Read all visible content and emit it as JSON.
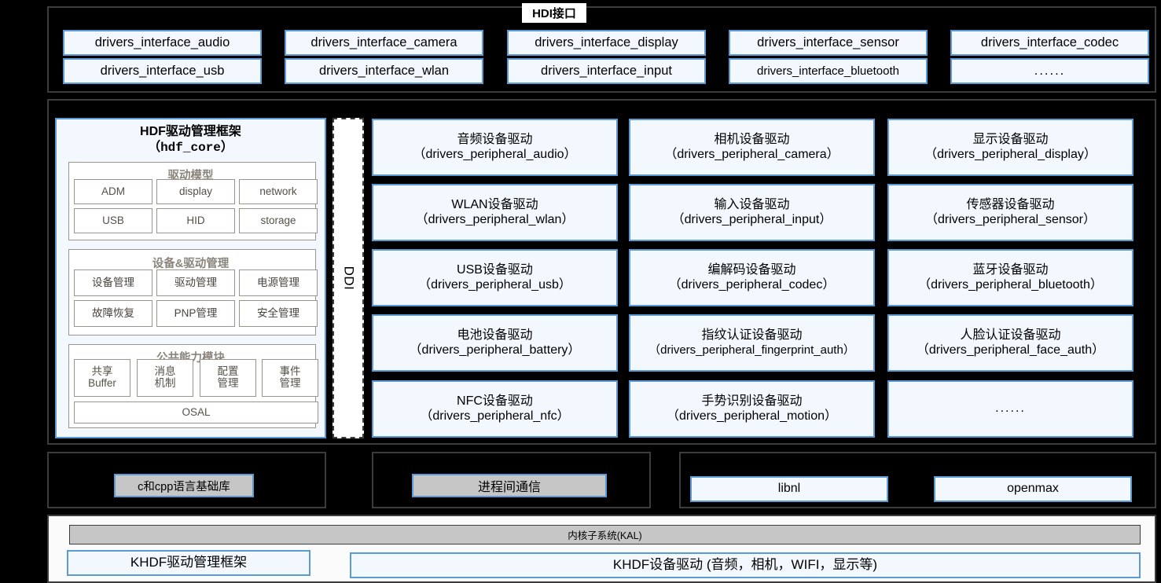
{
  "hdi": {
    "label": "HDI接口"
  },
  "interfaces": [
    {
      "name": "drivers_interface_audio"
    },
    {
      "name": "drivers_interface_usb"
    },
    {
      "name": "drivers_interface_camera"
    },
    {
      "name": "drivers_interface_wlan"
    },
    {
      "name": "drivers_interface_display"
    },
    {
      "name": "drivers_interface_input"
    },
    {
      "name": "drivers_interface_sensor"
    },
    {
      "name": "drivers_interface_bluetooth"
    },
    {
      "name": "drivers_interface_codec"
    },
    {
      "name": "......"
    }
  ],
  "ddi": {
    "label": "DDI"
  },
  "hdf_core": {
    "title": "HDF驱动管理框架",
    "subtitle": "（hdf_core）",
    "groups": [
      {
        "title": "驱动模型",
        "cells": [
          "ADM",
          "display",
          "network",
          "USB",
          "HID",
          "storage"
        ]
      },
      {
        "title": "设备&驱动管理",
        "cells": [
          "设备管理",
          "驱动管理",
          "电源管理",
          "故障恢复",
          "PNP管理",
          "安全管理"
        ]
      },
      {
        "title": "公共能力模块",
        "cells": [
          "共享\nBuffer",
          "消息\n机制",
          "配置\n管理",
          "事件\n管理"
        ],
        "osal": "OSAL"
      }
    ]
  },
  "peripherals": [
    {
      "cn": "音频设备驱动",
      "en": "（drivers_peripheral_audio）"
    },
    {
      "cn": "相机设备驱动",
      "en": "（drivers_peripheral_camera）"
    },
    {
      "cn": "显示设备驱动",
      "en": "（drivers_peripheral_display）"
    },
    {
      "cn": "WLAN设备驱动",
      "en": "（drivers_peripheral_wlan）"
    },
    {
      "cn": "输入设备驱动",
      "en": "（drivers_peripheral_input）"
    },
    {
      "cn": "传感器设备驱动",
      "en": "（drivers_peripheral_sensor）"
    },
    {
      "cn": "USB设备驱动",
      "en": "（drivers_peripheral_usb）"
    },
    {
      "cn": "编解码设备驱动",
      "en": "（drivers_peripheral_codec）"
    },
    {
      "cn": "蓝牙设备驱动",
      "en": "（drivers_peripheral_bluetooth）"
    },
    {
      "cn": "电池设备驱动",
      "en": "（drivers_peripheral_battery）"
    },
    {
      "cn": "指纹认证设备驱动",
      "en": "（drivers_peripheral_fingerprint_auth）"
    },
    {
      "cn": "人脸认证设备驱动",
      "en": "（drivers_peripheral_face_auth）"
    },
    {
      "cn": "NFC设备驱动",
      "en": "（drivers_peripheral_nfc）"
    },
    {
      "cn": "手势识别设备驱动",
      "en": "（drivers_peripheral_motion）"
    },
    {
      "cn": "......",
      "en": ""
    }
  ],
  "libs": {
    "lang": "c和cpp语言基础库",
    "ipc": "进程间通信",
    "libnl": "libnl",
    "openmax": "openmax"
  },
  "kernel": {
    "kal": "内核子系统(KAL)",
    "khdf_framework": "KHDF驱动管理框架",
    "khdf_drivers": "KHDF设备驱动 (音频，相机，WIFI，显示等)"
  },
  "colors": {
    "box_fill": "#f2f8fd",
    "box_border": "#5b9bd5",
    "gray_fill": "#c6c6c6",
    "frame_border": "#3c3c3c",
    "background": "#000000",
    "inner_border": "#9a948c"
  }
}
